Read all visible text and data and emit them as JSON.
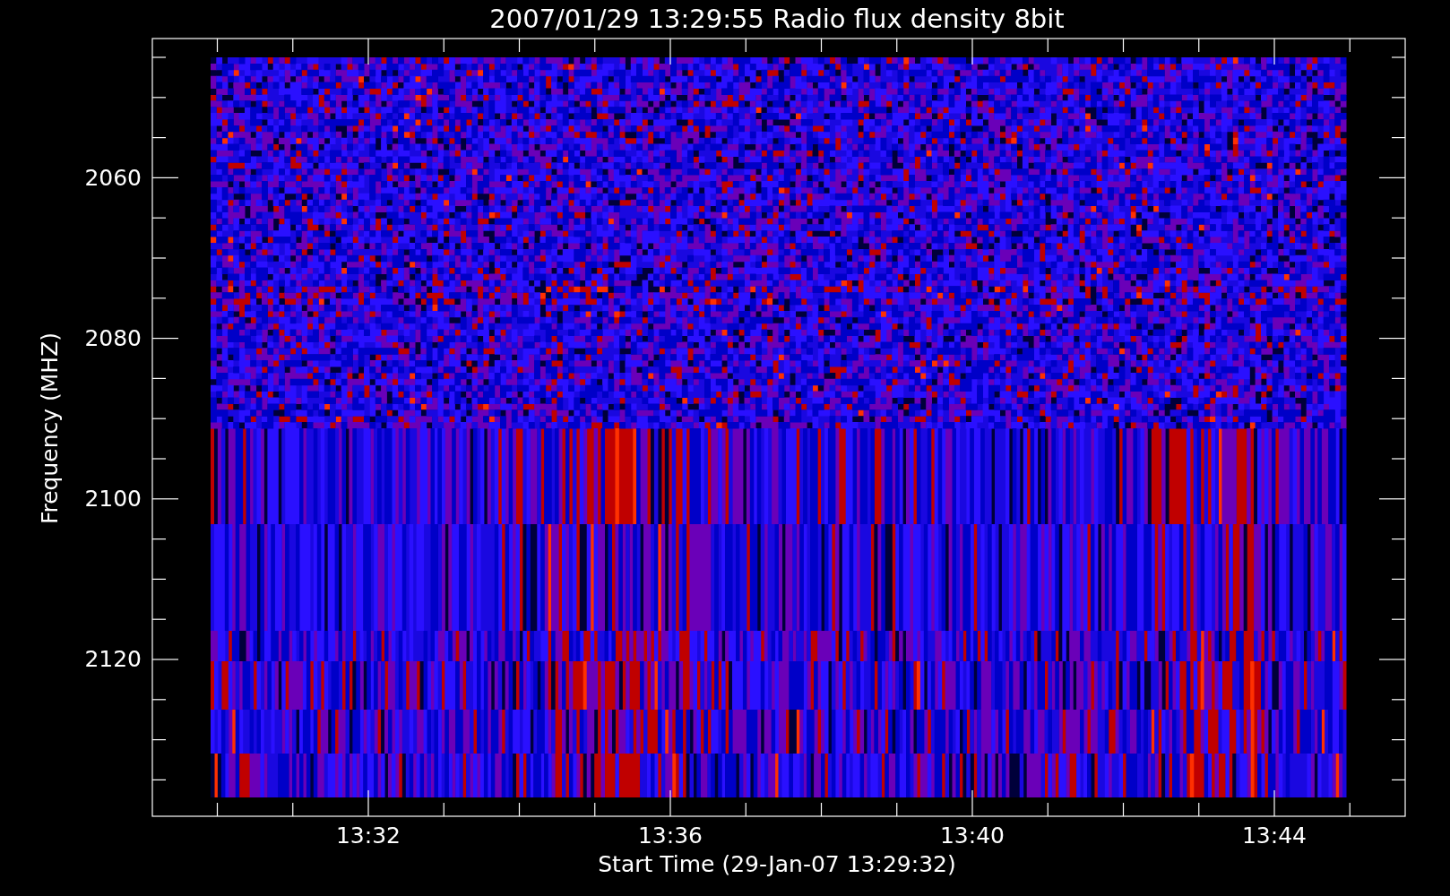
{
  "title": "2007/01/29 13:29:55 Radio flux density 8bit",
  "y_axis": {
    "label": "Frequency (MHZ)",
    "ticks": [
      "2060",
      "2080",
      "2100",
      "2120"
    ]
  },
  "x_axis": {
    "label": "Start Time (29-Jan-07 13:29:32)",
    "ticks": [
      "13:32",
      "13:36",
      "13:40",
      "13:44"
    ]
  }
}
